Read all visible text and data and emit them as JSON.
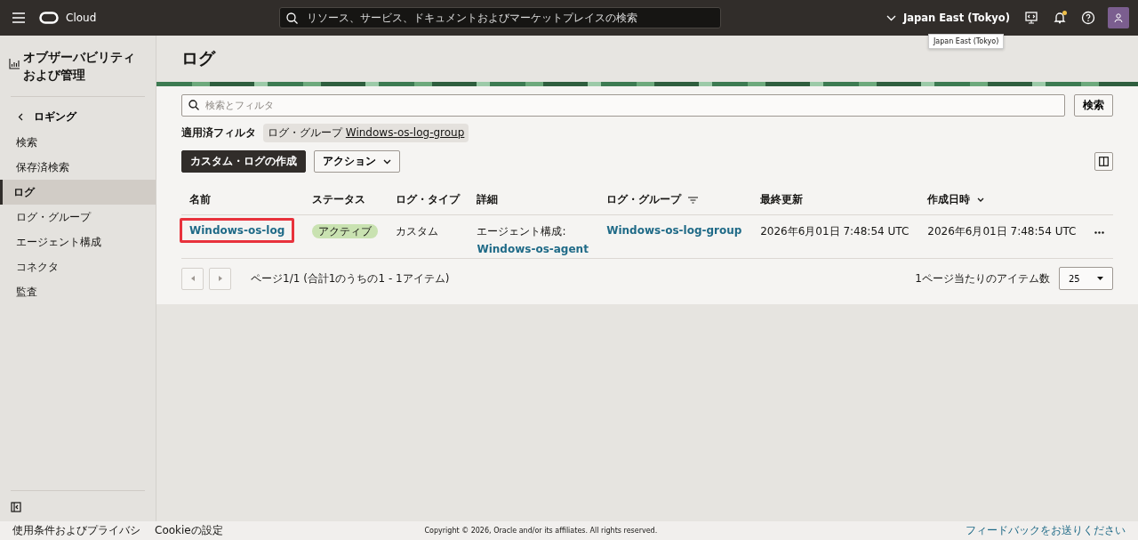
{
  "top_bar": {
    "brand": "Cloud",
    "search_placeholder": "リソース、サービス、ドキュメントおよびマーケットプレイスの検索",
    "region": "Japan East (Tokyo)",
    "tooltip": "Japan East (Tokyo)",
    "notification_dot": true
  },
  "sidebar": {
    "title": "オブザーバビリティおよび管理",
    "back": "ロギング",
    "items": [
      {
        "label": "検索",
        "selected": false
      },
      {
        "label": "保存済検索",
        "selected": false
      },
      {
        "label": "ログ",
        "selected": true
      },
      {
        "label": "ログ・グループ",
        "selected": false
      },
      {
        "label": "エージェント構成",
        "selected": false
      },
      {
        "label": "コネクタ",
        "selected": false
      },
      {
        "label": "監査",
        "selected": false
      }
    ]
  },
  "page": {
    "title": "ログ",
    "search_placeholder": "検索とフィルタ",
    "search_button": "検索",
    "applied_filters_label": "適用済フィルタ",
    "filter": {
      "prefix": "ログ・グループ",
      "value": "Windows-os-log-group"
    },
    "create_button": "カスタム・ログの作成",
    "actions_button": "アクション"
  },
  "table": {
    "columns": [
      {
        "label": "名前"
      },
      {
        "label": "ステータス"
      },
      {
        "label": "ログ・タイプ"
      },
      {
        "label": "詳細"
      },
      {
        "label": "ログ・グループ",
        "filter_icon": true
      },
      {
        "label": "最終更新"
      },
      {
        "label": "作成日時",
        "sort_icon": true
      }
    ],
    "rows": [
      {
        "name": "Windows-os-log",
        "highlighted": true,
        "status": "アクティブ",
        "type": "カスタム",
        "details_label": "エージェント構成:",
        "details_link": "Windows-os-agent",
        "log_group": "Windows-os-log-group",
        "updated": "2026年6月01日 7:48:54 UTC",
        "created": "2026年6月01日 7:48:54 UTC"
      }
    ]
  },
  "pagination": {
    "summary": "ページ1/1 (合計1のうちの1 - 1アイテム)",
    "per_page_label": "1ページ当たりのアイテム数",
    "per_page": "25"
  },
  "footer": {
    "links": [
      "使用条件およびプライバシ",
      "Cookieの設定"
    ],
    "copyright": "Copyright © 2026, Oracle and/or its affiliates. All rights reserved.",
    "feedback": "フィードバックをお送りください"
  }
}
